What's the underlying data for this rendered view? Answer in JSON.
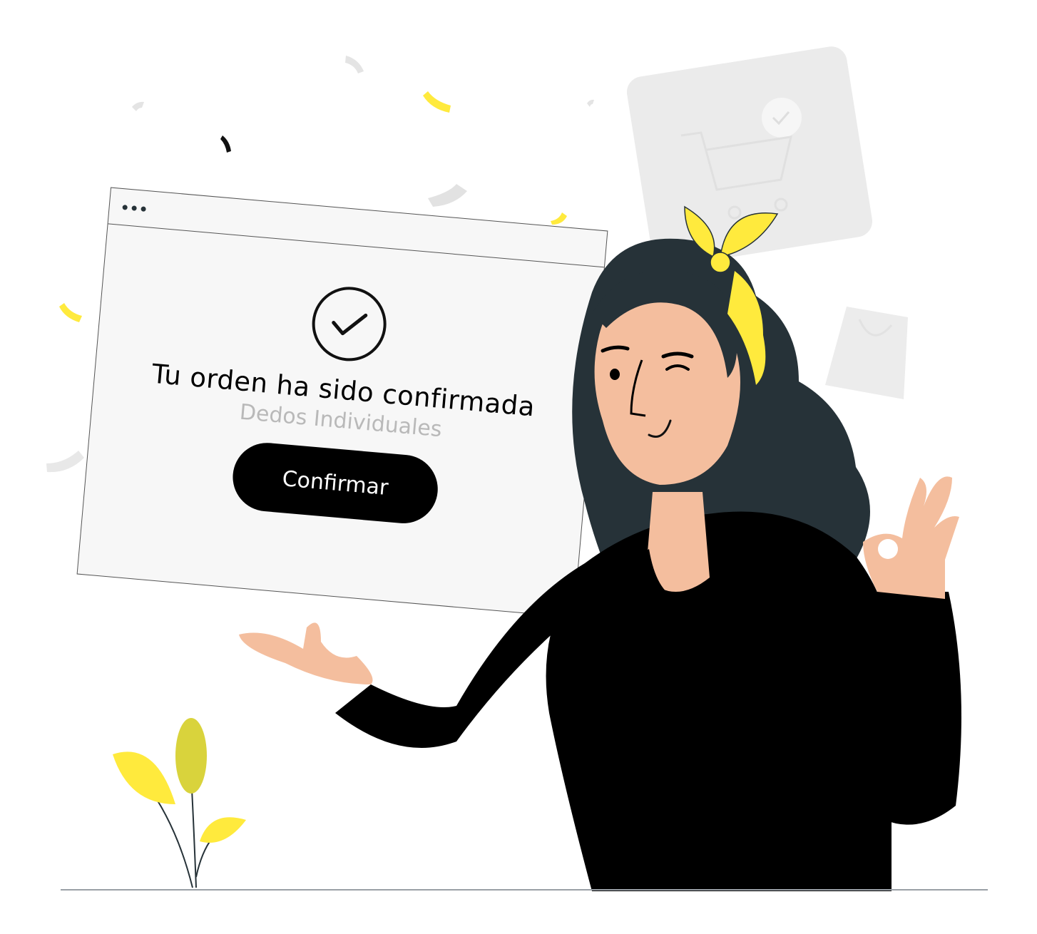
{
  "dialog": {
    "title": "Tu orden ha sido confirmada",
    "subtitle": "Dedos Individuales",
    "button_label": "Confirmar"
  },
  "icons": {
    "window_dots": "window-dots-icon",
    "success_check": "check-circle-icon",
    "cart": "shopping-cart-icon",
    "bag": "shopping-bag-icon"
  },
  "colors": {
    "accent_yellow": "#FFEA3D",
    "button_bg": "#000000",
    "button_text": "#FFFFFF",
    "subtitle": "#B9B9B9",
    "window_bg": "#F7F7F7",
    "hair": "#263238",
    "skin": "#F4BE9E"
  }
}
